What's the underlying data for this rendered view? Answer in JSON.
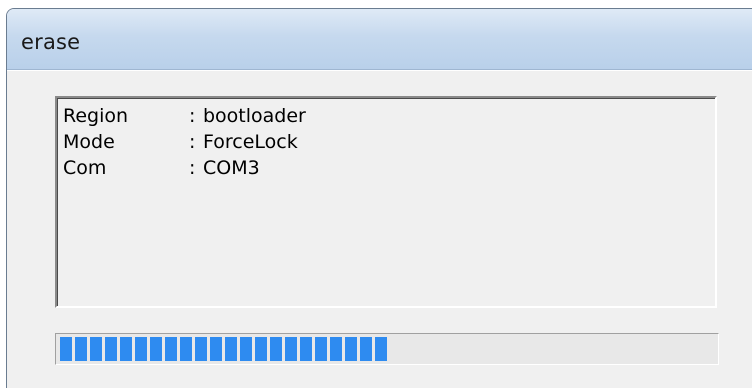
{
  "window": {
    "title": "erase"
  },
  "log": {
    "lines": [
      {
        "key": "Region",
        "sep": ":",
        "value": "bootloader"
      },
      {
        "key": "Mode",
        "sep": ":",
        "value": "ForceLock"
      },
      {
        "key": "Com",
        "sep": ":",
        "value": "COM3"
      }
    ]
  },
  "progress": {
    "fraction": 0.5,
    "segment_color": "#2e8bf0"
  },
  "colors": {
    "titlebar_accent": "#b9d0ea",
    "window_background": "#f0f0f0"
  }
}
